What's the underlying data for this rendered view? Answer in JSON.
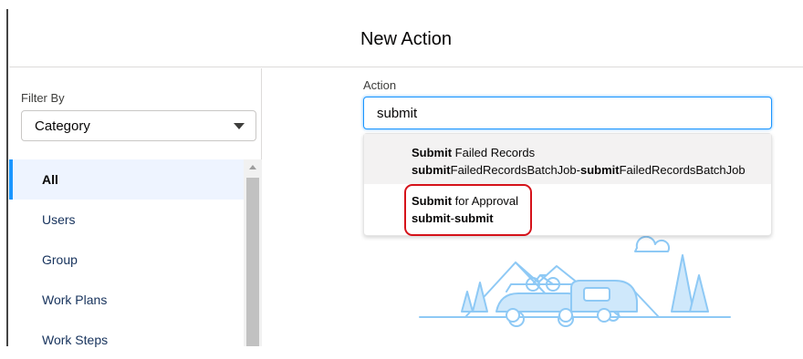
{
  "modal": {
    "title": "New Action"
  },
  "filter": {
    "label": "Filter By",
    "selected": "Category"
  },
  "categories": [
    {
      "label": "All",
      "active": true
    },
    {
      "label": "Users",
      "active": false
    },
    {
      "label": "Group",
      "active": false
    },
    {
      "label": "Work Plans",
      "active": false
    },
    {
      "label": "Work Steps",
      "active": false
    }
  ],
  "action": {
    "label": "Action",
    "value": "submit",
    "options": [
      {
        "title_bold": "Submit",
        "title_rest": " Failed Records",
        "api_parts": [
          {
            "text": "submit",
            "bold": true
          },
          {
            "text": "FailedRecordsBatchJob-",
            "bold": false
          },
          {
            "text": "submit",
            "bold": true
          },
          {
            "text": "FailedRecordsBatchJob",
            "bold": false
          }
        ]
      },
      {
        "title_bold": "Submit",
        "title_rest": " for Approval",
        "api_parts": [
          {
            "text": "submit",
            "bold": true
          },
          {
            "text": "-",
            "bold": false
          },
          {
            "text": "submit",
            "bold": true
          }
        ]
      }
    ]
  },
  "colors": {
    "accent": "#1b96ff",
    "highlight": "#d5121a",
    "illustration": "#8ec9f5"
  },
  "icons": [
    "dropdown-caret-icon",
    "scroll-up-arrow-icon",
    "camping-trailer-illustration"
  ]
}
